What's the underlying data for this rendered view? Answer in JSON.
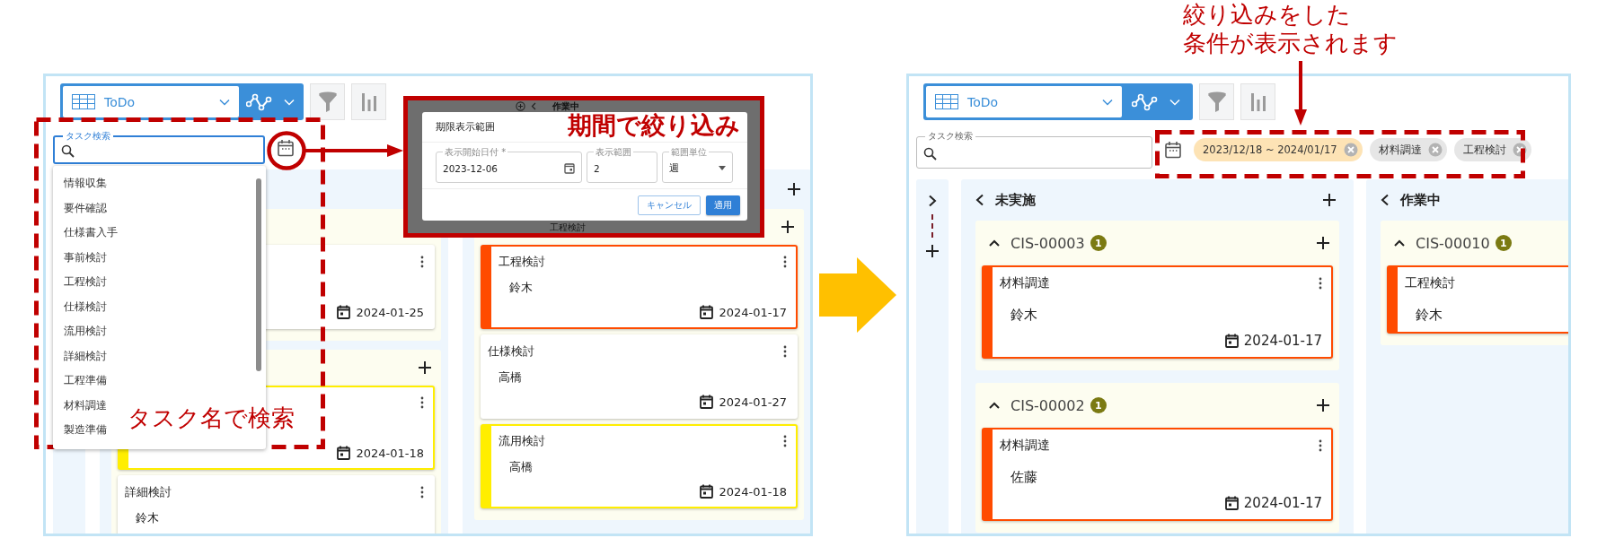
{
  "screens": [
    {
      "view_select": {
        "label": "ToDo"
      },
      "search": {
        "label": "タスク検索",
        "focused": true
      },
      "suggestions": [
        "情報収集",
        "要件確認",
        "仕様書入手",
        "事前検討",
        "工程検討",
        "仕様検討",
        "流用検討",
        "詳細検討",
        "工程準備",
        "材料調達",
        "製造準備"
      ],
      "columns": [
        {
          "groups": [
            {
              "cards": [
                {
                  "due": "2024-01-25"
                }
              ]
            },
            {
              "cards": [
                {
                  "color": "#ffee00",
                  "due": "2024-01-18"
                },
                {
                  "title": "詳細検討",
                  "assignee": "鈴木"
                }
              ]
            }
          ]
        },
        {
          "groups": [
            {
              "cards": [
                {
                  "title": "工程検討",
                  "assignee": "鈴木",
                  "due": "2024-01-17",
                  "color": "#ff4b00"
                },
                {
                  "title": "仕様検討",
                  "assignee": "高橋",
                  "due": "2024-01-27"
                },
                {
                  "title": "流用検討",
                  "assignee": "高橋",
                  "due": "2024-01-18",
                  "color": "#ffee00"
                }
              ]
            }
          ]
        }
      ],
      "period_dialog": {
        "background_texts": [
          "作業中",
          "工程検討"
        ],
        "title": "期限表示範囲",
        "fields": [
          {
            "label": "表示開始日付 *",
            "value": "2023-12-06",
            "kind": "date"
          },
          {
            "label": "表示範囲",
            "value": "2",
            "kind": "text"
          },
          {
            "label": "範囲単位",
            "value": "週",
            "kind": "select"
          }
        ],
        "buttons": [
          {
            "label": "キャンセル",
            "primary": false
          },
          {
            "label": "適用",
            "primary": true
          }
        ]
      }
    },
    {
      "view_select": {
        "label": "ToDo"
      },
      "search": {
        "label": "タスク検索",
        "focused": false
      },
      "filter_chips": [
        {
          "label": "2023/12/18 ~ 2024/01/17",
          "kind": "period"
        },
        {
          "label": "材料調達",
          "kind": "task"
        },
        {
          "label": "工程検討",
          "kind": "task"
        }
      ],
      "columns": [
        {
          "title": "未実施",
          "groups": [
            {
              "title": "CIS-00003",
              "count": "1",
              "cards": [
                {
                  "title": "材料調達",
                  "assignee": "鈴木",
                  "due": "2024-01-17",
                  "color": "#ff4b00"
                }
              ]
            },
            {
              "title": "CIS-00002",
              "count": "1",
              "cards": [
                {
                  "title": "材料調達",
                  "assignee": "佐藤",
                  "due": "2024-01-17",
                  "color": "#ff4b00"
                }
              ]
            }
          ]
        },
        {
          "title": "作業中",
          "groups": [
            {
              "title": "CIS-00010",
              "count": "1",
              "cards": [
                {
                  "title": "工程検討",
                  "assignee": "鈴木",
                  "color": "#ff4b00"
                }
              ]
            }
          ]
        }
      ]
    }
  ],
  "annotations": {
    "search_note": "タスク名で検索",
    "period_note": "期間で絞り込み",
    "filter_note": [
      "絞り込みをした",
      "条件が表示されます"
    ]
  }
}
